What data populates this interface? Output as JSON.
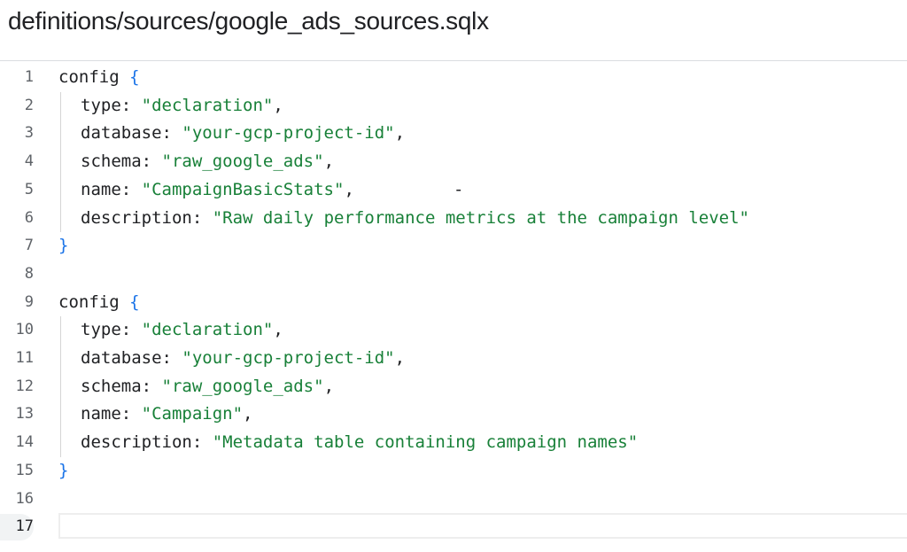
{
  "file": {
    "path": "definitions/sources/google_ads_sources.sqlx"
  },
  "editor": {
    "active_line": "17",
    "line_numbers": [
      "1",
      "2",
      "3",
      "4",
      "5",
      "6",
      "7",
      "8",
      "9",
      "10",
      "11",
      "12",
      "13",
      "14",
      "15",
      "16",
      "17"
    ],
    "stray_char": "-",
    "blocks": [
      {
        "keyword": "config",
        "open_brace": "{",
        "close_brace": "}",
        "fields": [
          {
            "key": "type",
            "value": "\"declaration\"",
            "trail": ","
          },
          {
            "key": "database",
            "value": "\"your-gcp-project-id\"",
            "trail": ","
          },
          {
            "key": "schema",
            "value": "\"raw_google_ads\"",
            "trail": ","
          },
          {
            "key": "name",
            "value": "\"CampaignBasicStats\"",
            "trail": ","
          },
          {
            "key": "description",
            "value": "\"Raw daily performance metrics at the campaign level\"",
            "trail": ""
          }
        ]
      },
      {
        "keyword": "config",
        "open_brace": "{",
        "close_brace": "}",
        "fields": [
          {
            "key": "type",
            "value": "\"declaration\"",
            "trail": ","
          },
          {
            "key": "database",
            "value": "\"your-gcp-project-id\"",
            "trail": ","
          },
          {
            "key": "schema",
            "value": "\"raw_google_ads\"",
            "trail": ","
          },
          {
            "key": "name",
            "value": "\"Campaign\"",
            "trail": ","
          },
          {
            "key": "description",
            "value": "\"Metadata table containing campaign names\"",
            "trail": ""
          }
        ]
      }
    ],
    "colors": {
      "string": "#188038",
      "brace": "#1a73e8",
      "text": "#202124",
      "gutter": "#5f6368"
    }
  }
}
